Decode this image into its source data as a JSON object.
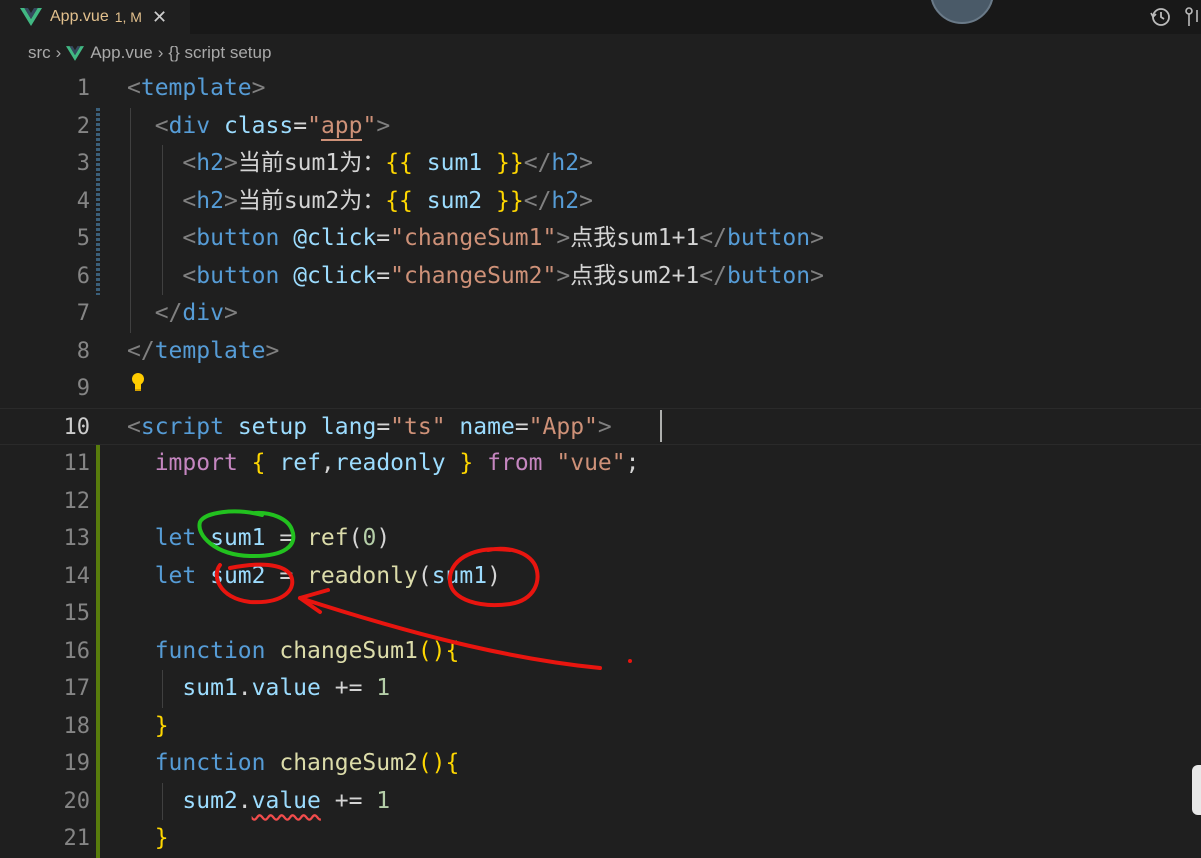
{
  "tab": {
    "file_name": "App.vue",
    "status": "1, M",
    "close_glyph": "✕",
    "icon": "vue-logo-icon",
    "color": "#e2c08d"
  },
  "breadcrumb": {
    "items": [
      "src",
      "App.vue",
      "{} script setup"
    ]
  },
  "editor": {
    "current_line": 10,
    "line_numbers": [
      "1",
      "2",
      "3",
      "4",
      "5",
      "6",
      "7",
      "8",
      "9",
      "10",
      "11",
      "12",
      "13",
      "14",
      "15",
      "16",
      "17",
      "18",
      "19",
      "20",
      "21"
    ],
    "lines": [
      [
        [
          "t-ang",
          "<"
        ],
        [
          "t-tag",
          "template"
        ],
        [
          "t-ang",
          ">"
        ]
      ],
      [
        [
          "t-plain",
          "  "
        ],
        [
          "t-ang",
          "<"
        ],
        [
          "t-tag",
          "div"
        ],
        [
          "t-plain",
          " "
        ],
        [
          "t-attr",
          "class"
        ],
        [
          "t-plain",
          "="
        ],
        [
          "t-str",
          "\""
        ],
        [
          "t-str app-underline",
          "app"
        ],
        [
          "t-str",
          "\""
        ],
        [
          "t-ang",
          ">"
        ]
      ],
      [
        [
          "t-plain",
          "    "
        ],
        [
          "t-ang",
          "<"
        ],
        [
          "t-tag",
          "h2"
        ],
        [
          "t-ang",
          ">"
        ],
        [
          "t-txt",
          "当前sum1为："
        ],
        [
          "t-br",
          "{{"
        ],
        [
          "t-plain",
          " "
        ],
        [
          "t-var",
          "sum1"
        ],
        [
          "t-plain",
          " "
        ],
        [
          "t-br",
          "}}"
        ],
        [
          "t-ang",
          "</"
        ],
        [
          "t-tag",
          "h2"
        ],
        [
          "t-ang",
          ">"
        ]
      ],
      [
        [
          "t-plain",
          "    "
        ],
        [
          "t-ang",
          "<"
        ],
        [
          "t-tag",
          "h2"
        ],
        [
          "t-ang",
          ">"
        ],
        [
          "t-txt",
          "当前sum2为："
        ],
        [
          "t-br",
          "{{"
        ],
        [
          "t-plain",
          " "
        ],
        [
          "t-var",
          "sum2"
        ],
        [
          "t-plain",
          " "
        ],
        [
          "t-br",
          "}}"
        ],
        [
          "t-ang",
          "</"
        ],
        [
          "t-tag",
          "h2"
        ],
        [
          "t-ang",
          ">"
        ]
      ],
      [
        [
          "t-plain",
          "    "
        ],
        [
          "t-ang",
          "<"
        ],
        [
          "t-tag",
          "button"
        ],
        [
          "t-plain",
          " "
        ],
        [
          "t-attr",
          "@click"
        ],
        [
          "t-plain",
          "="
        ],
        [
          "t-str",
          "\"changeSum1\""
        ],
        [
          "t-ang",
          ">"
        ],
        [
          "t-txt",
          "点我sum1+1"
        ],
        [
          "t-ang",
          "</"
        ],
        [
          "t-tag",
          "button"
        ],
        [
          "t-ang",
          ">"
        ]
      ],
      [
        [
          "t-plain",
          "    "
        ],
        [
          "t-ang",
          "<"
        ],
        [
          "t-tag",
          "button"
        ],
        [
          "t-plain",
          " "
        ],
        [
          "t-attr",
          "@click"
        ],
        [
          "t-plain",
          "="
        ],
        [
          "t-str",
          "\"changeSum2\""
        ],
        [
          "t-ang",
          ">"
        ],
        [
          "t-txt",
          "点我sum2+1"
        ],
        [
          "t-ang",
          "</"
        ],
        [
          "t-tag",
          "button"
        ],
        [
          "t-ang",
          ">"
        ]
      ],
      [
        [
          "t-plain",
          "  "
        ],
        [
          "t-ang",
          "</"
        ],
        [
          "t-tag",
          "div"
        ],
        [
          "t-ang",
          ">"
        ]
      ],
      [
        [
          "t-ang",
          "</"
        ],
        [
          "t-tag",
          "template"
        ],
        [
          "t-ang",
          ">"
        ]
      ],
      [],
      [
        [
          "t-ang",
          "<"
        ],
        [
          "t-tag",
          "script"
        ],
        [
          "t-plain",
          " "
        ],
        [
          "t-attr",
          "setup"
        ],
        [
          "t-plain",
          " "
        ],
        [
          "t-attr",
          "lang"
        ],
        [
          "t-plain",
          "="
        ],
        [
          "t-str",
          "\"ts\""
        ],
        [
          "t-plain",
          " "
        ],
        [
          "t-attr",
          "name"
        ],
        [
          "t-plain",
          "="
        ],
        [
          "t-str",
          "\"App\""
        ],
        [
          "t-ang",
          ">"
        ]
      ],
      [
        [
          "t-plain",
          "  "
        ],
        [
          "t-kw2",
          "import"
        ],
        [
          "t-plain",
          " "
        ],
        [
          "t-br",
          "{"
        ],
        [
          "t-plain",
          " "
        ],
        [
          "t-var",
          "ref"
        ],
        [
          "t-plain",
          ","
        ],
        [
          "t-var",
          "readonly"
        ],
        [
          "t-plain",
          " "
        ],
        [
          "t-br",
          "}"
        ],
        [
          "t-plain",
          " "
        ],
        [
          "t-kw2",
          "from"
        ],
        [
          "t-plain",
          " "
        ],
        [
          "t-str",
          "\"vue\""
        ],
        [
          "t-plain",
          ";"
        ]
      ],
      [],
      [
        [
          "t-plain",
          "  "
        ],
        [
          "t-kw",
          "let"
        ],
        [
          "t-plain",
          " "
        ],
        [
          "t-var",
          "sum1"
        ],
        [
          "t-plain",
          " = "
        ],
        [
          "t-fn",
          "ref"
        ],
        [
          "t-plain",
          "("
        ],
        [
          "t-num",
          "0"
        ],
        [
          "t-plain",
          ")"
        ]
      ],
      [
        [
          "t-plain",
          "  "
        ],
        [
          "t-kw",
          "let"
        ],
        [
          "t-plain",
          " "
        ],
        [
          "t-var",
          "sum2"
        ],
        [
          "t-plain",
          " = "
        ],
        [
          "t-fn",
          "readonly"
        ],
        [
          "t-plain",
          "("
        ],
        [
          "t-var",
          "sum1"
        ],
        [
          "t-plain",
          ")"
        ]
      ],
      [],
      [
        [
          "t-plain",
          "  "
        ],
        [
          "t-kw",
          "function"
        ],
        [
          "t-plain",
          " "
        ],
        [
          "t-fn",
          "changeSum1"
        ],
        [
          "t-br",
          "()"
        ],
        [
          "t-br",
          "{"
        ]
      ],
      [
        [
          "t-plain",
          "    "
        ],
        [
          "t-var",
          "sum1"
        ],
        [
          "t-plain",
          "."
        ],
        [
          "t-var",
          "value"
        ],
        [
          "t-plain",
          " += "
        ],
        [
          "t-num",
          "1"
        ]
      ],
      [
        [
          "t-plain",
          "  "
        ],
        [
          "t-br",
          "}"
        ]
      ],
      [
        [
          "t-plain",
          "  "
        ],
        [
          "t-kw",
          "function"
        ],
        [
          "t-plain",
          " "
        ],
        [
          "t-fn",
          "changeSum2"
        ],
        [
          "t-br",
          "()"
        ],
        [
          "t-br",
          "{"
        ]
      ],
      [
        [
          "t-plain",
          "    "
        ],
        [
          "t-var",
          "sum2"
        ],
        [
          "t-plain",
          "."
        ],
        [
          "t-var squiggle",
          "value"
        ],
        [
          "t-plain",
          " += "
        ],
        [
          "t-num",
          "1"
        ]
      ],
      [
        [
          "t-plain",
          "  "
        ],
        [
          "t-br",
          "}"
        ]
      ]
    ],
    "lightbulb_icon": "lightbulb-icon",
    "annotation_colors": {
      "green": "#22c11f",
      "red": "#e8150f"
    }
  }
}
